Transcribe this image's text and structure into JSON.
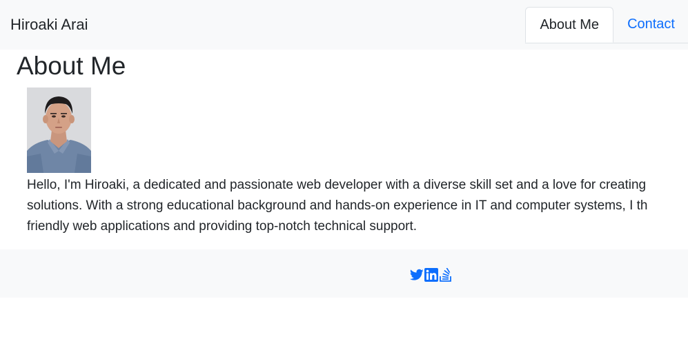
{
  "header": {
    "brand": "Hiroaki Arai",
    "nav": [
      {
        "label": "About Me",
        "active": true
      },
      {
        "label": "Contact",
        "active": false
      }
    ]
  },
  "main": {
    "title": "About Me",
    "bio_lines": [
      "Hello, I'm Hiroaki, a dedicated and passionate web developer with a diverse skill set and a love for creating",
      "solutions. With a strong educational background and hands-on experience in IT and computer systems, I th",
      "friendly web applications and providing top-notch technical support."
    ]
  },
  "footer": {
    "social_icons": [
      "twitter-icon",
      "linkedin-icon",
      "stack-overflow-icon"
    ]
  },
  "colors": {
    "link": "#0d6efd",
    "navbar_bg": "#f8f9fa",
    "text": "#212529"
  }
}
